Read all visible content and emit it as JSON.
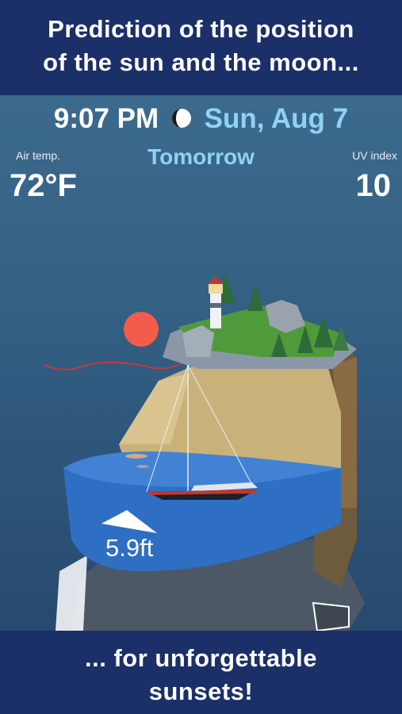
{
  "banner_top": {
    "line1": "Prediction of the position",
    "line2": "of the sun and the moon..."
  },
  "header": {
    "time": "9:07 PM",
    "date": "Sun, Aug 7",
    "moon_icon": "moon-phase-icon"
  },
  "air_temp": {
    "label": "Air temp.",
    "value": "72°F"
  },
  "day_label": "Tomorrow",
  "uv": {
    "label": "UV index",
    "value": "10"
  },
  "tide": {
    "depth": "5.9ft",
    "direction_icon": "tide-up-arrow-icon"
  },
  "banner_bottom": {
    "line1": "... for unforgettable",
    "line2": "sunsets!"
  },
  "colors": {
    "banner": "#1b2f68",
    "accent": "#8fd3f2",
    "sun": "#f25c4b",
    "sand": "#c9b27a",
    "water": "#2e6fc4",
    "grass": "#4f9a3a"
  }
}
